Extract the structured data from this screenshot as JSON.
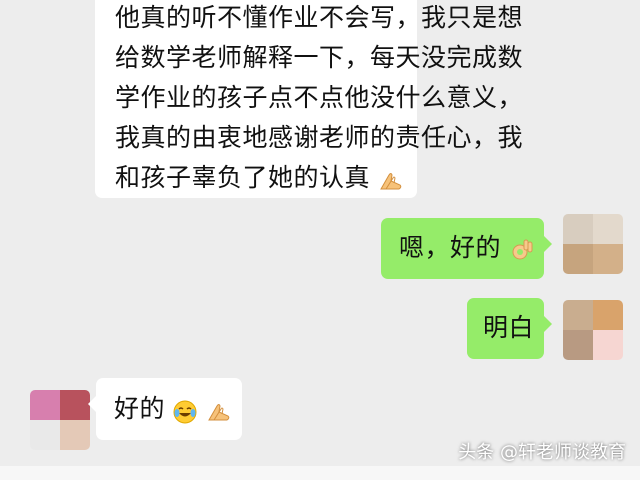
{
  "messages": [
    {
      "side": "left",
      "lines": [
        "他真的听不懂作业不会写，我只是想",
        "给数学老师解释一下，每天没完成数",
        "学作业的孩子点不点他没什么意义，",
        "我真的由衷地感谢老师的责任心，我",
        "和孩子辜负了她的认真"
      ],
      "trailing_emoji": "hands-together-emoji"
    },
    {
      "side": "right",
      "text": "嗯，好的",
      "trailing_emoji": "ok-hand-emoji"
    },
    {
      "side": "right",
      "text": "明白"
    },
    {
      "side": "left",
      "text": "好的",
      "trailing_emojis": [
        "crying-laughing-emoji",
        "hands-together-emoji"
      ]
    }
  ],
  "watermark": "头条 @轩老师谈教育",
  "colors": {
    "background": "#ededed",
    "incoming_bubble": "#ffffff",
    "outgoing_bubble": "#95ec69"
  }
}
